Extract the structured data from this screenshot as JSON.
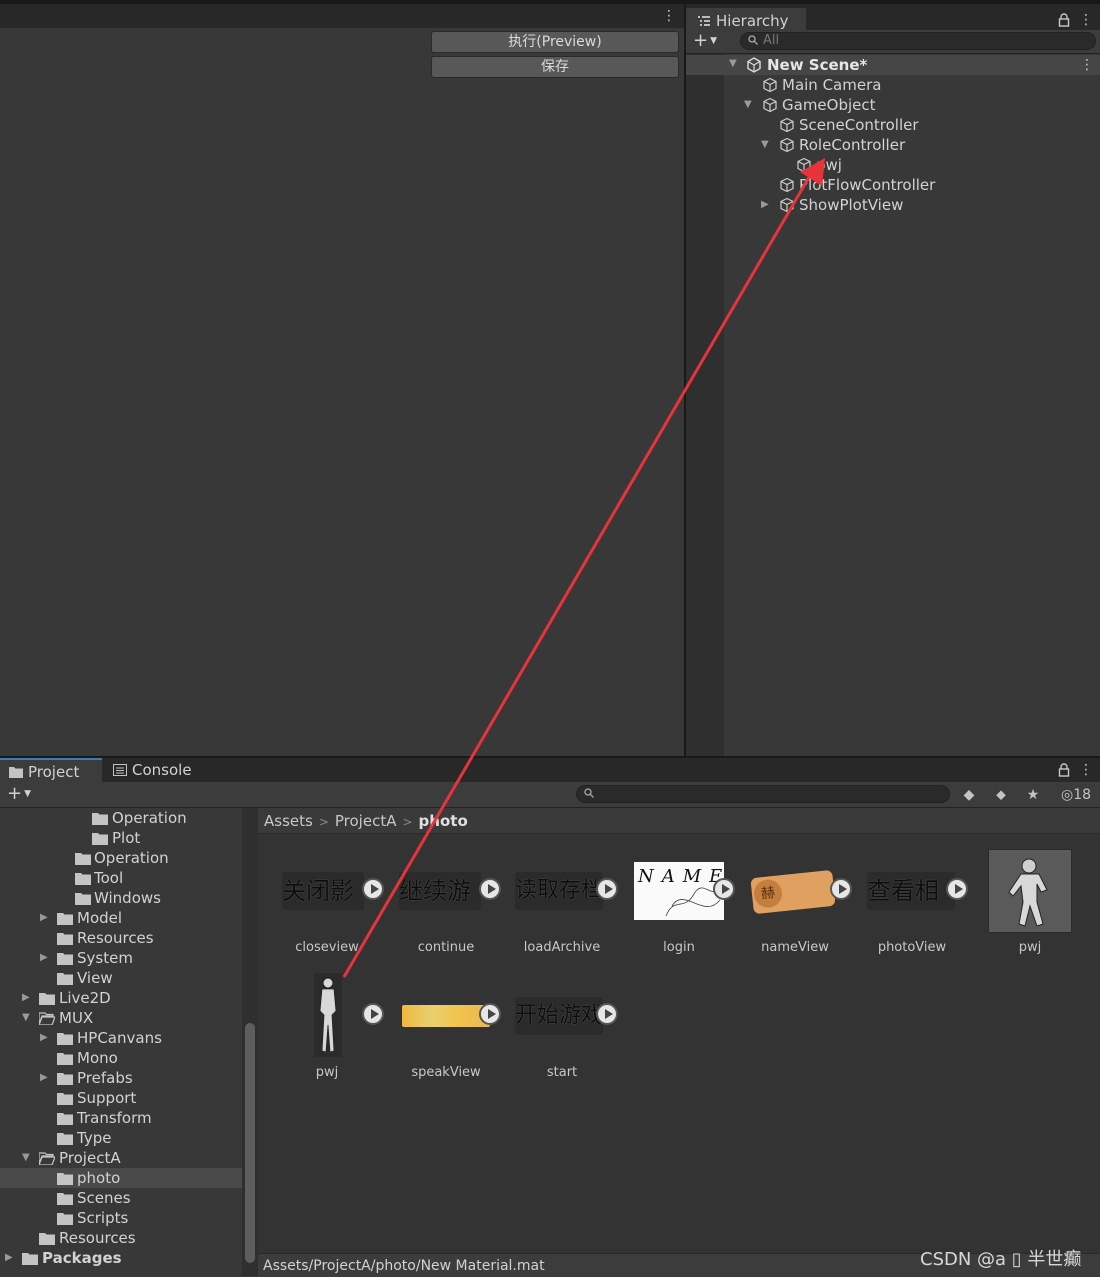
{
  "editor": {
    "buttons": {
      "preview": "执行(Preview)",
      "save": "保存"
    }
  },
  "hierarchy": {
    "tab_label": "Hierarchy",
    "search_placeholder": "All",
    "scene_name": "New Scene*",
    "items": [
      {
        "label": "Main Camera"
      },
      {
        "label": "GameObject",
        "expanded": true
      },
      {
        "label": "SceneController"
      },
      {
        "label": "RoleController",
        "expanded": true
      },
      {
        "label": "pwj"
      },
      {
        "label": "PlotFlowController"
      },
      {
        "label": "ShowPlotView",
        "collapsed": true
      }
    ]
  },
  "project": {
    "tabs": {
      "project": "Project",
      "console": "Console"
    },
    "hidden_count": "18",
    "tree": [
      {
        "label": "Operation"
      },
      {
        "label": "Plot"
      },
      {
        "label": "Operation"
      },
      {
        "label": "Tool"
      },
      {
        "label": "Windows"
      },
      {
        "label": "Model"
      },
      {
        "label": "Resources"
      },
      {
        "label": "System"
      },
      {
        "label": "View"
      },
      {
        "label": "Live2D"
      },
      {
        "label": "MUX"
      },
      {
        "label": "HPCanvans"
      },
      {
        "label": "Mono"
      },
      {
        "label": "Prefabs"
      },
      {
        "label": "Support"
      },
      {
        "label": "Transform"
      },
      {
        "label": "Type"
      },
      {
        "label": "ProjectA"
      },
      {
        "label": "photo",
        "selected": true
      },
      {
        "label": "Scenes"
      },
      {
        "label": "Scripts"
      },
      {
        "label": "Resources"
      },
      {
        "label": "Packages"
      }
    ],
    "breadcrumb": [
      "Assets",
      "ProjectA",
      "photo"
    ],
    "assets": [
      {
        "name": "closeview",
        "thumb_text": "关闭影"
      },
      {
        "name": "continue",
        "thumb_text": "继续游"
      },
      {
        "name": "loadArchive",
        "thumb_text": "读取存档"
      },
      {
        "name": "login",
        "thumb_text": "NAME"
      },
      {
        "name": "nameView",
        "thumb_text": "赫"
      },
      {
        "name": "photoView",
        "thumb_text": "查看相"
      },
      {
        "name": "pwj"
      },
      {
        "name": "pwj"
      },
      {
        "name": "speakView"
      },
      {
        "name": "start",
        "thumb_text": "开始游戏"
      }
    ],
    "status_path": "Assets/ProjectA/photo/New Material.mat"
  },
  "watermark": "CSDN @a ▯ 半世癫",
  "colors": {
    "annotation_arrow": "#e8333a",
    "selection": "#4a4a4a",
    "tab_accent": "#3a79bb"
  }
}
